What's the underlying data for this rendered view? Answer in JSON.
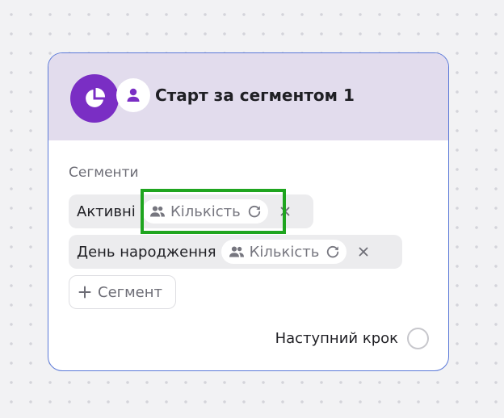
{
  "node": {
    "title": "Старт за сегментом 1",
    "type_icon": "pie-chart-icon",
    "subject_icon": "user-icon",
    "header_color": "#e2dced",
    "icon_color": "#7a2ec4",
    "border_color": "#5b79d8"
  },
  "segments": {
    "label": "Сегменти",
    "items": [
      {
        "name": "Активні",
        "count_label": "Кількість",
        "count_icon": "people-icon",
        "refresh_icon": "refresh-icon",
        "remove_icon": "close-icon"
      },
      {
        "name": "День народження",
        "count_label": "Кількість",
        "count_icon": "people-icon",
        "refresh_icon": "refresh-icon",
        "remove_icon": "close-icon"
      }
    ],
    "add_button": {
      "label": "Сегмент",
      "icon": "plus-icon"
    }
  },
  "next_step": {
    "label": "Наступний крок",
    "connector_icon": "circle-connector-icon"
  },
  "highlight": {
    "target": "count-chip of segment \"Активні\"",
    "color": "#1fa51f"
  }
}
